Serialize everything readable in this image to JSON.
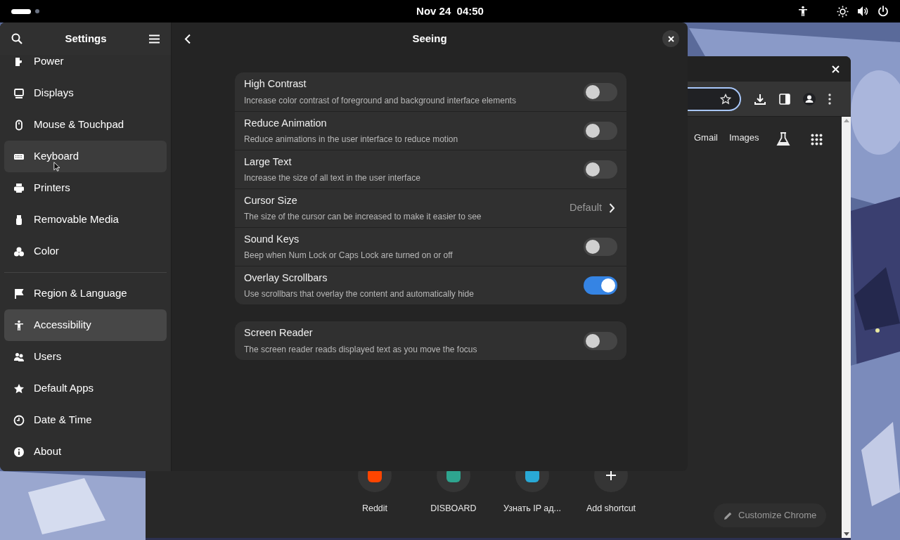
{
  "top_bar": {
    "clock": "Nov 24  04:50"
  },
  "browser": {
    "links": [
      "Gmail",
      "Images"
    ],
    "shortcuts": [
      {
        "kind": "site",
        "label": "Reddit",
        "color": "#ff4500"
      },
      {
        "kind": "site",
        "label": "DISBOARD",
        "color": "#2ea58f"
      },
      {
        "kind": "site",
        "label": "Узнать IP ад...",
        "color": "#29a9d6"
      },
      {
        "kind": "add",
        "label": "Add shortcut"
      }
    ],
    "customize_button": "Customize Chrome"
  },
  "settings": {
    "sidebar_title": "Settings",
    "page_title": "Seeing",
    "sidebar_groups": [
      [
        {
          "label": "Power",
          "selected": false,
          "hovered": false
        },
        {
          "label": "Displays",
          "selected": false,
          "hovered": false
        },
        {
          "label": "Mouse & Touchpad",
          "selected": false,
          "hovered": false
        },
        {
          "label": "Keyboard",
          "selected": false,
          "hovered": true
        },
        {
          "label": "Printers",
          "selected": false,
          "hovered": false
        },
        {
          "label": "Removable Media",
          "selected": false,
          "hovered": false
        },
        {
          "label": "Color",
          "selected": false,
          "hovered": false
        }
      ],
      [
        {
          "label": "Region & Language",
          "selected": false,
          "hovered": false
        },
        {
          "label": "Accessibility",
          "selected": true,
          "hovered": false
        },
        {
          "label": "Users",
          "selected": false,
          "hovered": false
        },
        {
          "label": "Default Apps",
          "selected": false,
          "hovered": false
        },
        {
          "label": "Date & Time",
          "selected": false,
          "hovered": false
        },
        {
          "label": "About",
          "selected": false,
          "hovered": false
        }
      ]
    ],
    "cards": [
      [
        {
          "kind": "toggle",
          "title": "High Contrast",
          "subtitle": "Increase color contrast of foreground and background interface elements",
          "on": false
        },
        {
          "kind": "toggle",
          "title": "Reduce Animation",
          "subtitle": "Reduce animations in the user interface to reduce motion",
          "on": false
        },
        {
          "kind": "toggle",
          "title": "Large Text",
          "subtitle": "Increase the size of all text in the user interface",
          "on": false
        },
        {
          "kind": "link",
          "title": "Cursor Size",
          "subtitle": "The size of the cursor can be increased to make it easier to see",
          "value": "Default"
        },
        {
          "kind": "toggle",
          "title": "Sound Keys",
          "subtitle": "Beep when Num Lock or Caps Lock are turned on or off",
          "on": false
        },
        {
          "kind": "toggle",
          "title": "Overlay Scrollbars",
          "subtitle": "Use scrollbars that overlay the content and automatically hide",
          "on": true
        }
      ],
      [
        {
          "kind": "toggle",
          "title": "Screen Reader",
          "subtitle": "The screen reader reads displayed text as you move the focus",
          "on": false
        }
      ]
    ]
  }
}
